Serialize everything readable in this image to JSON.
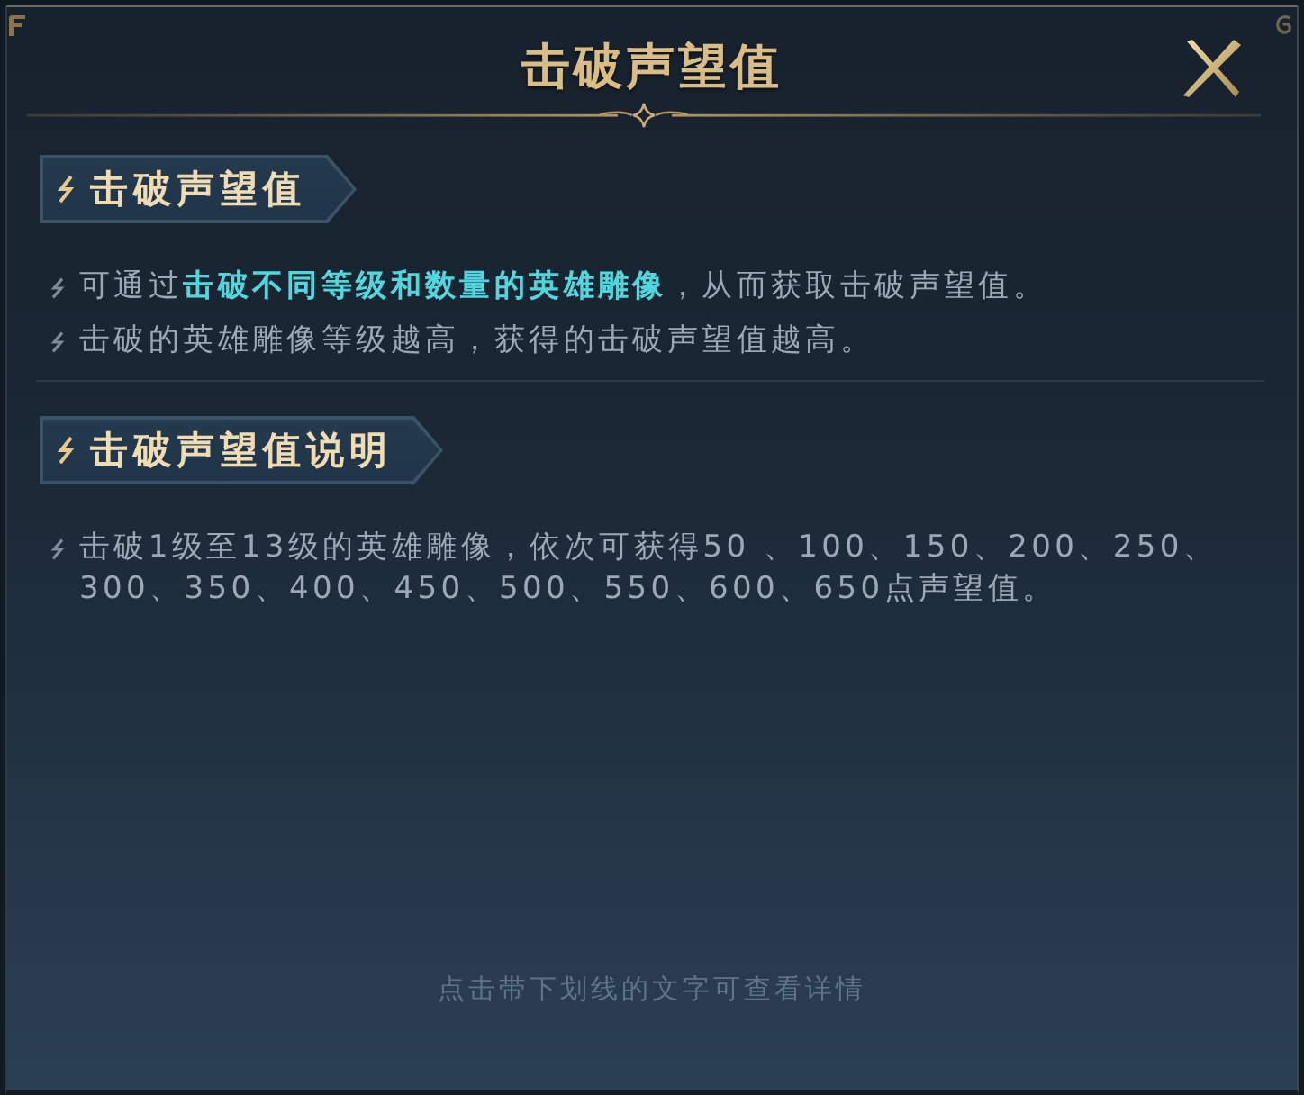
{
  "window": {
    "title": "击破声望值"
  },
  "sections": [
    {
      "heading": "击破声望值",
      "bullets": [
        "可通过**击破不同等级和数量的英雄雕像**，从而获取击破声望值。",
        "击破的英雄雕像等级越高，获得的击破声望值越高。"
      ]
    },
    {
      "heading": "击破声望值说明",
      "bullets": [
        "击破1级至13级的英雄雕像，依次可获得50 、100、150、200、250、300、350、400、450、500、550、600、650点声望值。"
      ]
    }
  ],
  "hint": "点击带下划线的文字可查看详情"
}
